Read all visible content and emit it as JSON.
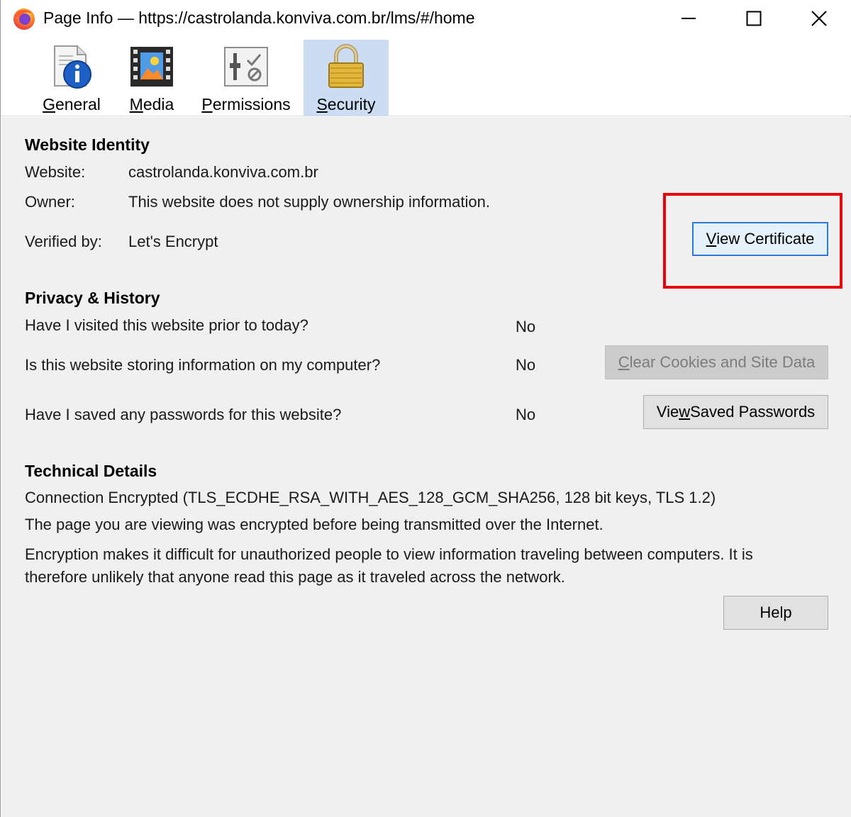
{
  "window": {
    "title": "Page Info — https://castrolanda.konviva.com.br/lms/#/home",
    "controls": {
      "minimize": "minimize-icon",
      "maximize": "maximize-icon",
      "close": "close-icon"
    }
  },
  "tabs": [
    {
      "label": "General",
      "accel": "G",
      "rest": "eneral",
      "icon": "info-icon",
      "selected": false
    },
    {
      "label": "Media",
      "accel": "M",
      "rest": "edia",
      "icon": "media-icon",
      "selected": false
    },
    {
      "label": "Permissions",
      "accel": "P",
      "rest": "ermissions",
      "icon": "permissions-icon",
      "selected": false
    },
    {
      "label": "Security",
      "accel": "S",
      "rest": "ecurity",
      "icon": "lock-icon",
      "selected": true
    }
  ],
  "identity": {
    "heading": "Website Identity",
    "website_label": "Website:",
    "website_value": "castrolanda.konviva.com.br",
    "owner_label": "Owner:",
    "owner_value": "This website does not supply ownership information.",
    "verified_label": "Verified by:",
    "verified_value": "Let's Encrypt",
    "view_cert": {
      "accel": "V",
      "rest": "iew Certificate"
    }
  },
  "privacy": {
    "heading": "Privacy & History",
    "q1": "Have I visited this website prior to today?",
    "a1": "No",
    "q2": "Is this website storing information on my computer?",
    "a2": "No",
    "clear_btn": {
      "accel": "C",
      "rest": "lear Cookies and Site Data"
    },
    "q3": "Have I saved any passwords for this website?",
    "a3": "No",
    "passwords_btn": {
      "pre": "Vie",
      "accel": "w",
      "rest": " Saved Passwords"
    }
  },
  "technical": {
    "heading": "Technical Details",
    "line1": "Connection Encrypted (TLS_ECDHE_RSA_WITH_AES_128_GCM_SHA256, 128 bit keys, TLS 1.2)",
    "line2": "The page you are viewing was encrypted before being transmitted over the Internet.",
    "line3a": "Encryption makes it difficult for unauthorized people to view information traveling between computers. It is",
    "line3b": "therefore unlikely that anyone read this page as it traveled across the network."
  },
  "help_label": "Help",
  "colors": {
    "highlight": "#e8000b",
    "selected_tab": "#ccdcf2",
    "focus_border": "#2b7ad7"
  }
}
